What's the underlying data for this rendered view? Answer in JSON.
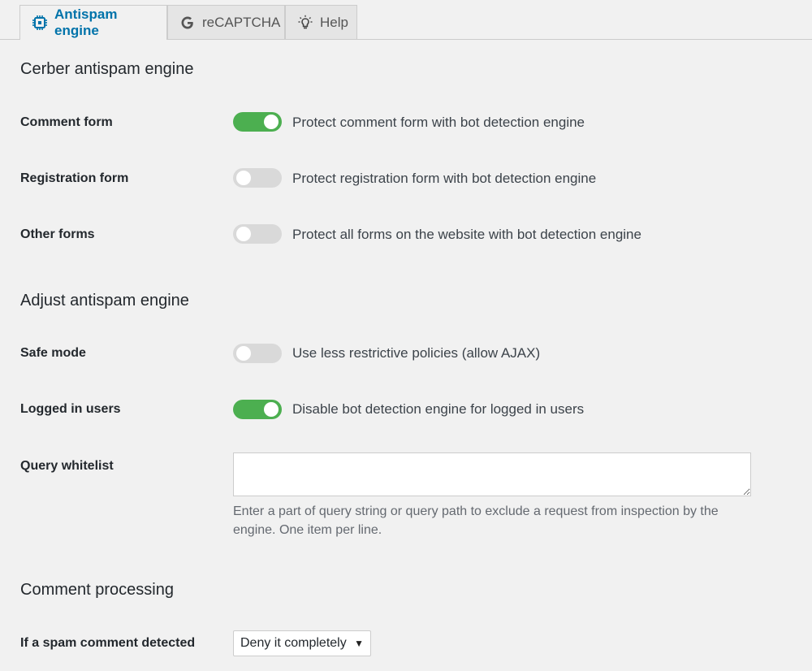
{
  "tabs": [
    {
      "label": "Antispam engine",
      "icon": "chip-icon",
      "active": true
    },
    {
      "label": "reCAPTCHA",
      "icon": "google-g-icon",
      "active": false
    },
    {
      "label": "Help",
      "icon": "lightbulb-icon",
      "active": false
    }
  ],
  "sections": {
    "cerber": {
      "title": "Cerber antispam engine"
    },
    "adjust": {
      "title": "Adjust antispam engine"
    },
    "comment": {
      "title": "Comment processing"
    }
  },
  "rows": {
    "comment_form": {
      "label": "Comment form",
      "enabled": true,
      "description": "Protect comment form with bot detection engine"
    },
    "registration_form": {
      "label": "Registration form",
      "enabled": false,
      "description": "Protect registration form with bot detection engine"
    },
    "other_forms": {
      "label": "Other forms",
      "enabled": false,
      "description": "Protect all forms on the website with bot detection engine"
    },
    "safe_mode": {
      "label": "Safe mode",
      "enabled": false,
      "description": "Use less restrictive policies (allow AJAX)"
    },
    "logged_in": {
      "label": "Logged in users",
      "enabled": true,
      "description": "Disable bot detection engine for logged in users"
    },
    "query_whitelist": {
      "label": "Query whitelist",
      "value": "",
      "help": "Enter a part of query string or query path to exclude a request from inspection by the engine. One item per line."
    },
    "spam_comment": {
      "label": "If a spam comment detected",
      "selected": "Deny it completely"
    }
  },
  "colors": {
    "toggle_on": "#4caf50",
    "toggle_off": "#d9d9d9",
    "active_tab": "#0073aa"
  }
}
